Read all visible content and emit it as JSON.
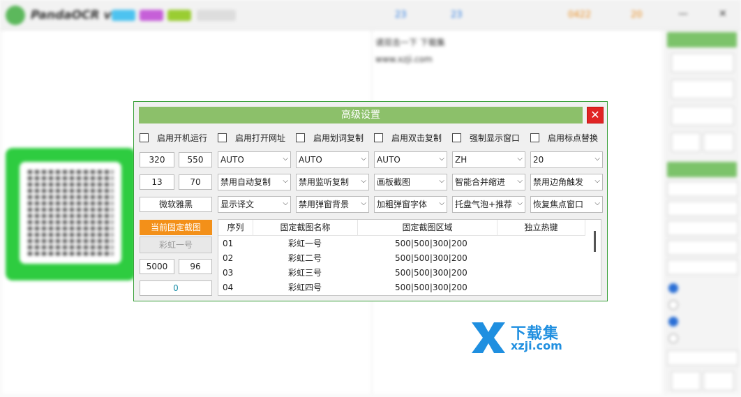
{
  "background": {
    "app_title": "PandaOCR v2.7",
    "title_numbers": [
      "23",
      "23",
      "0422",
      "20"
    ],
    "mid_text_lines": [
      "请双击一下 下载集",
      "www.xzji.com"
    ],
    "watermark": {
      "line1": "下载集",
      "line2": "xzji.com"
    }
  },
  "dialog": {
    "title": "高级设置",
    "close_label": "✕",
    "checkboxes": [
      "启用开机运行",
      "启用打开网址",
      "启用划词复制",
      "启用双击复制",
      "强制显示窗口",
      "启用标点替换"
    ],
    "row2": {
      "num1": "320",
      "num2": "550",
      "selects": [
        "AUTO",
        "AUTO",
        "AUTO",
        "ZH",
        "20"
      ]
    },
    "row3": {
      "num1": "13",
      "num2": "70",
      "selects": [
        "禁用自动复制",
        "禁用监听复制",
        "画板截图",
        "智能合并缩进",
        "禁用边角触发"
      ]
    },
    "row4": {
      "font_value": "微软雅黑",
      "selects": [
        "显示译文",
        "禁用弹窗背景",
        "加粗弹窗字体",
        "托盘气泡+推荐",
        "恢复焦点窗口"
      ]
    },
    "left_controls": {
      "current_fixed_label": "当前固定截图",
      "current_fixed_value": "彩虹一号",
      "num1": "5000",
      "num2": "96",
      "counter": "0"
    },
    "table": {
      "headers": [
        "序列",
        "固定截图名称",
        "固定截图区域",
        "独立热键"
      ],
      "rows": [
        {
          "seq": "01",
          "name": "彩虹一号",
          "area": "500|500|300|200",
          "hotkey": ""
        },
        {
          "seq": "02",
          "name": "彩虹二号",
          "area": "500|500|300|200",
          "hotkey": ""
        },
        {
          "seq": "03",
          "name": "彩虹三号",
          "area": "500|500|300|200",
          "hotkey": ""
        },
        {
          "seq": "04",
          "name": "彩虹四号",
          "area": "500|500|300|200",
          "hotkey": ""
        }
      ]
    }
  }
}
